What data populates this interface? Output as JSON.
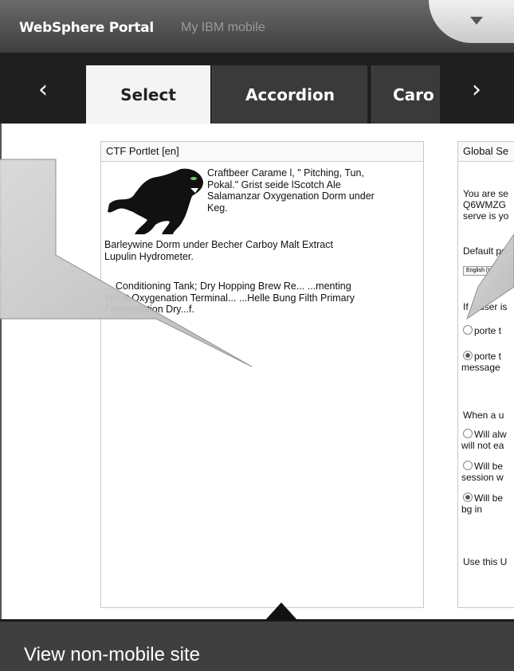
{
  "header": {
    "brand": "WebSphere Portal",
    "subtitle": "My IBM mobile"
  },
  "tabs": {
    "prev": "‹",
    "next": "›",
    "items": [
      {
        "label": "Select"
      },
      {
        "label": "Accordion"
      },
      {
        "label": "Caro"
      }
    ]
  },
  "ctf_portlet": {
    "title": "CTF Portlet [en]",
    "text_beside_image": "Craftbeer Carame l, \" Pitching, Tun, Pokal.\" Grist seide lScotch Ale Salamanzar Oxygenation Dorm under Keg.",
    "text_continued": "Barleywine Dorm under Becher Carboy Malt Extract Lupulin Hydrometer.",
    "text_paragraph": "... Conditioning Tank; Dry Hopping Brew Re... ...menting Yeast Oxygenation Terminal... ...Helle Bung Filth Primary Fermentation Dry...f."
  },
  "global_portlet": {
    "title": "Global Se",
    "intro_lines": [
      "You are se",
      "Q6WMZG",
      "serve is yo"
    ],
    "default_label": "Default po",
    "default_select": "English (U",
    "question1": "If a user is",
    "opt1": "porte t",
    "opt2": "porte t",
    "opt2_cont": "message",
    "question2": "When a u",
    "opt3": "Will alw",
    "opt3_cont": "will not ea",
    "opt4": "Will be",
    "opt4_cont": "session w",
    "opt5": "Will be",
    "opt5_cont": "bg in",
    "use_label": "Use this U"
  },
  "footer": {
    "link": "View non-mobile site"
  },
  "colors": {
    "topbar": "#4a4a4a",
    "tabbar": "#1f1f1f",
    "active_tab": "#f4f4f4",
    "footer": "#3f3f3f",
    "callout": "#c4c4c4"
  }
}
